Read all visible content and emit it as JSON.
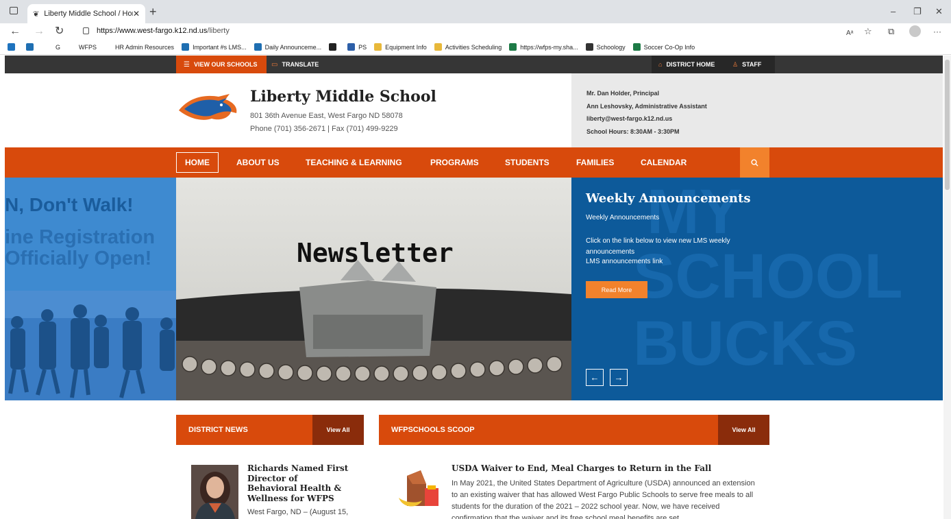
{
  "browser": {
    "tab_title": "Liberty Middle School / Homepa",
    "url_host": "https://www.west-fargo.k12.nd.us",
    "url_path": "/liberty",
    "bookmarks": [
      {
        "label": "",
        "color": "#1e73be"
      },
      {
        "label": "",
        "color": "#1f6fb2"
      },
      {
        "label": "G",
        "color": ""
      },
      {
        "label": "WFPS",
        "color": ""
      },
      {
        "label": "HR Admin Resources",
        "color": ""
      },
      {
        "label": "Important #s LMS...",
        "color": "#1f6fb2"
      },
      {
        "label": "Daily Announceme...",
        "color": "#1f6fb2"
      },
      {
        "label": "",
        "color": "#222"
      },
      {
        "label": "PS",
        "color": "#2d5fa8"
      },
      {
        "label": "Equipment Info",
        "color": "#e8b83a"
      },
      {
        "label": "Activities Scheduling",
        "color": "#e8b83a"
      },
      {
        "label": "https://wfps-my.sha...",
        "color": "#1d7a46"
      },
      {
        "label": "Schoology",
        "color": "#333"
      },
      {
        "label": "Soccer Co-Op Info",
        "color": "#1d7a46"
      }
    ]
  },
  "site": {
    "topbar": {
      "view_schools": "VIEW OUR SCHOOLS",
      "translate": "TRANSLATE",
      "district_home": "DISTRICT HOME",
      "staff": "STAFF"
    },
    "school_name": "Liberty Middle School",
    "address": "801 36th Avenue East, West Fargo ND 58078",
    "phone": "Phone (701) 356-2671  |  Fax (701) 499-9229",
    "info": {
      "principal": "Mr. Dan Holder, Principal",
      "assistant": "Ann Leshovsky, Administrative Assistant",
      "email": "liberty@west-fargo.k12.nd.us",
      "hours": "School Hours: 8:30AM - 3:30PM"
    },
    "nav": [
      "HOME",
      "ABOUT US",
      "TEACHING & LEARNING",
      "PROGRAMS",
      "STUDENTS",
      "FAMILIES",
      "CALENDAR"
    ],
    "hero": {
      "left_line1": "N, Don't Walk!",
      "left_line2": "ine Registration",
      "left_line3": "Officially Open!",
      "center_word": "Newsletter",
      "bg_word1": "MY",
      "bg_word2": "SCHOOL",
      "bg_word3": "BUCKS",
      "title": "Weekly Announcements",
      "subtitle": "Weekly Announcements",
      "body": "Click on the link below to view new LMS weekly announcements",
      "link": "LMS announcements link",
      "read_more": "Read More"
    },
    "district_news": {
      "heading": "DISTRICT NEWS",
      "view_all": "View All",
      "title": "Richards Named First Director of Behavioral Health & Wellness for WFPS",
      "snippet": "West Fargo, ND – (August 15,"
    },
    "scoop": {
      "heading": "WFPSCHOOLS SCOOP",
      "view_all": "View All",
      "title": "USDA Waiver to End, Meal Charges to Return in the Fall",
      "body": "In May 2021, the United States Department of Agriculture (USDA) announced an extension to an existing waiver that has allowed West Fargo Public Schools to serve free meals to all students for the duration of the 2021 – 2022 school year. Now, we have received confirmation that the waiver and its free school meal benefits are set"
    }
  },
  "colors": {
    "brand_orange": "#d84a0c",
    "accent_orange": "#f2822c",
    "hero_blue": "#0d5a9a",
    "topbar_dark": "#363636"
  },
  "icons": [
    "menu-icon",
    "chat-icon",
    "home-icon",
    "person-icon",
    "search-icon",
    "arrow-left-icon",
    "arrow-right-icon"
  ]
}
